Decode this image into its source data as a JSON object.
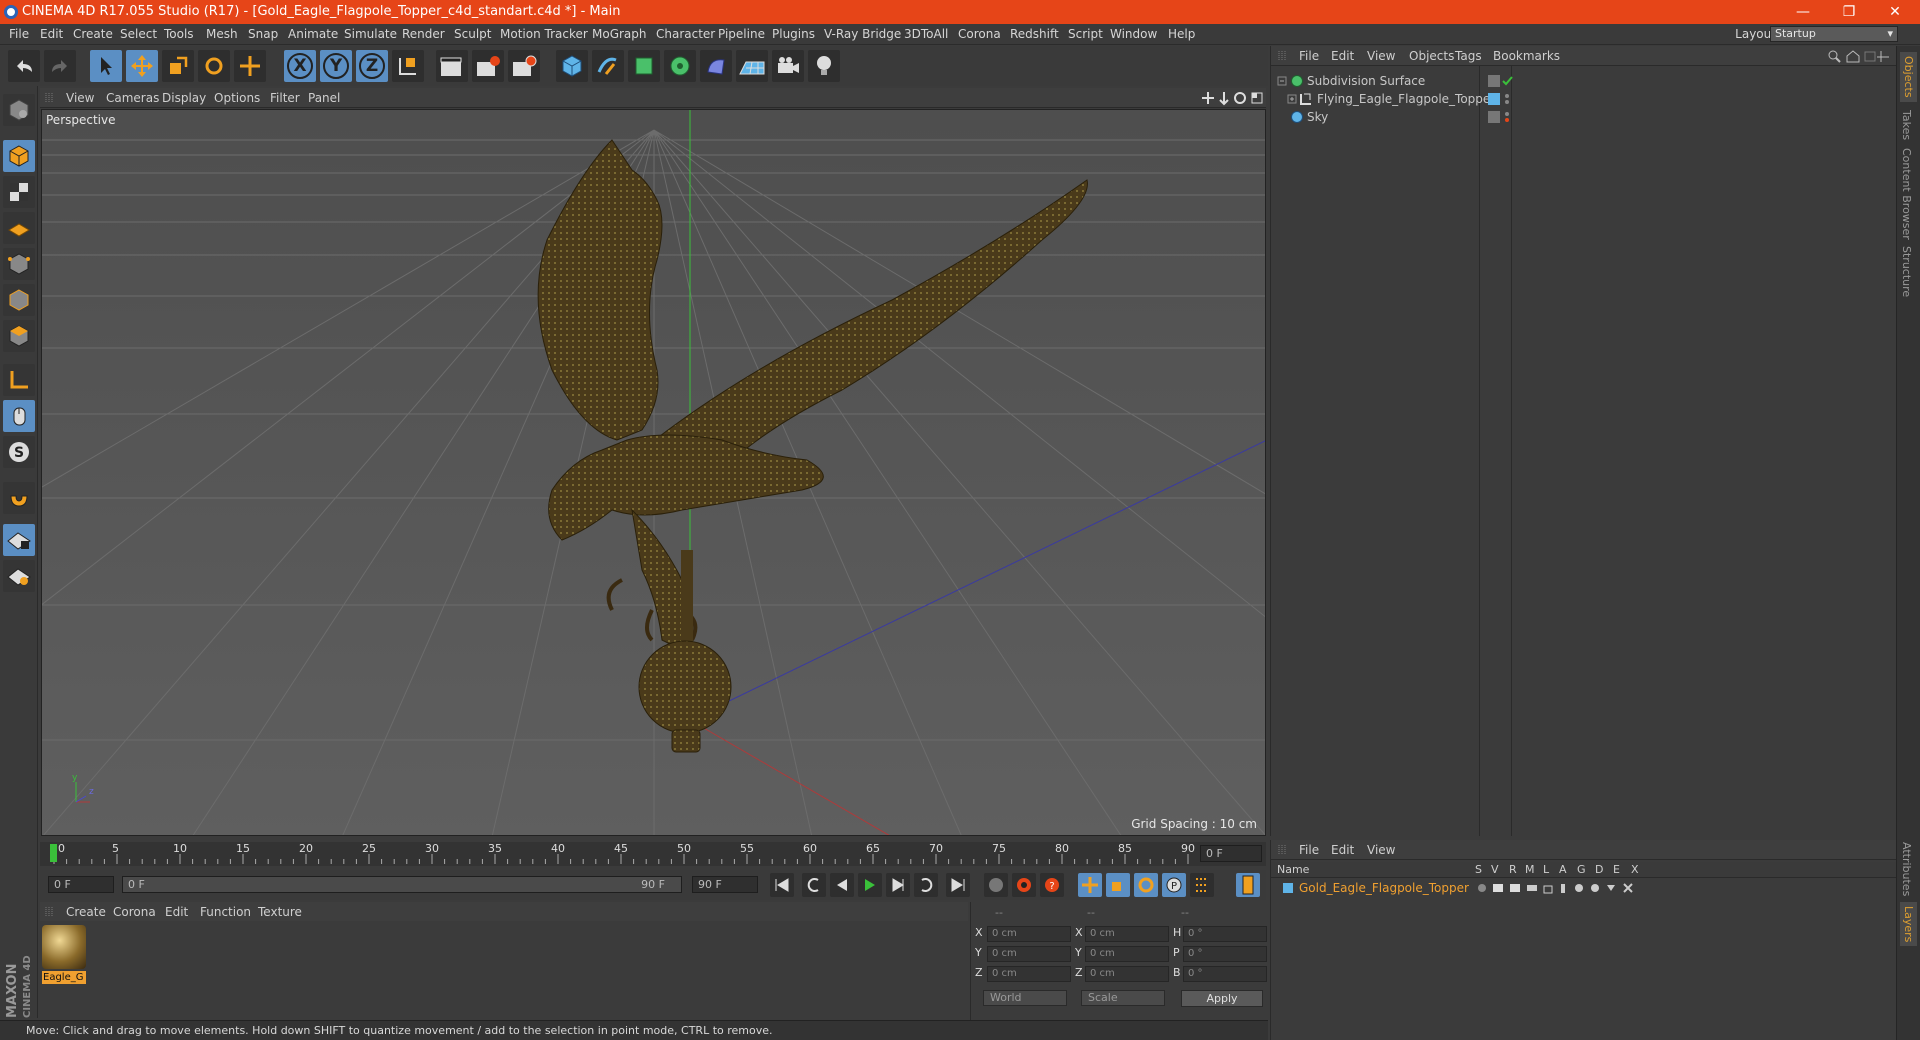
{
  "window": {
    "title": "CINEMA 4D R17.055 Studio (R17) - [Gold_Eagle_Flagpole_Topper_c4d_standart.c4d *] - Main",
    "minimize": "—",
    "maximize": "❐",
    "close": "✕"
  },
  "menu": [
    "File",
    "Edit",
    "Create",
    "Select",
    "Tools",
    "Mesh",
    "Snap",
    "Animate",
    "Simulate",
    "Render",
    "Sculpt",
    "Motion Tracker",
    "MoGraph",
    "Character",
    "Pipeline",
    "Plugins",
    "V-Ray Bridge",
    "3DToAll",
    "Corona",
    "Redshift",
    "Script",
    "Window",
    "Help"
  ],
  "layout": {
    "label": "Layout:",
    "value": "Startup"
  },
  "toolbar": {
    "x_axis": "X",
    "y_axis": "Y",
    "z_axis": "Z"
  },
  "viewport": {
    "menu": [
      "View",
      "Cameras",
      "Display",
      "Options",
      "Filter",
      "Panel"
    ],
    "camera": "Perspective",
    "grid_spacing": "Grid Spacing : 10 cm",
    "axis_y": "y",
    "axis_z": "z",
    "axis_x": "x"
  },
  "timeline": {
    "ticks": [
      "0",
      "5",
      "10",
      "15",
      "20",
      "25",
      "30",
      "35",
      "40",
      "45",
      "50",
      "55",
      "60",
      "65",
      "70",
      "75",
      "80",
      "85",
      "90"
    ],
    "current_frame": "0 F",
    "start_field": "0 F",
    "range_start": "0 F",
    "range_end": "90 F",
    "end_field": "90 F"
  },
  "material_manager": {
    "menu": [
      "Create",
      "Corona",
      "Edit",
      "Function",
      "Texture"
    ],
    "material_name": "Eagle_G"
  },
  "coordinates": {
    "headers": [
      "--",
      "--",
      "--"
    ],
    "rows": [
      {
        "l1": "X",
        "v1": "0 cm",
        "l2": "X",
        "v2": "0 cm",
        "l3": "H",
        "v3": "0 °"
      },
      {
        "l1": "Y",
        "v1": "0 cm",
        "l2": "Y",
        "v2": "0 cm",
        "l3": "P",
        "v3": "0 °"
      },
      {
        "l1": "Z",
        "v1": "0 cm",
        "l2": "Z",
        "v2": "0 cm",
        "l3": "B",
        "v3": "0 °"
      }
    ],
    "mode": "World",
    "type": "Scale",
    "apply": "Apply"
  },
  "object_manager": {
    "menu": [
      "File",
      "Edit",
      "View",
      "Objects",
      "Tags",
      "Bookmarks"
    ],
    "objects": [
      {
        "name": "Subdivision Surface"
      },
      {
        "name": "Flying_Eagle_Flagpole_Topper"
      },
      {
        "name": "Sky"
      }
    ]
  },
  "layer_manager": {
    "menu": [
      "File",
      "Edit",
      "View"
    ],
    "columns": [
      "Name",
      "S",
      "V",
      "R",
      "M",
      "L",
      "A",
      "G",
      "D",
      "E",
      "X"
    ],
    "layer": "Gold_Eagle_Flagpole_Topper"
  },
  "right_tabs": [
    "Objects",
    "Takes",
    "Content Browser",
    "Structure",
    "Attributes",
    "Layers"
  ],
  "status": "Move: Click and drag to move elements. Hold down SHIFT to quantize movement / add to the selection in point mode, CTRL to remove.",
  "brand": {
    "line1": "MAXON",
    "line2": "CINEMA 4D"
  },
  "colors": {
    "accent": "#e64518",
    "highlight": "#5b8fc4",
    "selection": "#f0a030"
  }
}
